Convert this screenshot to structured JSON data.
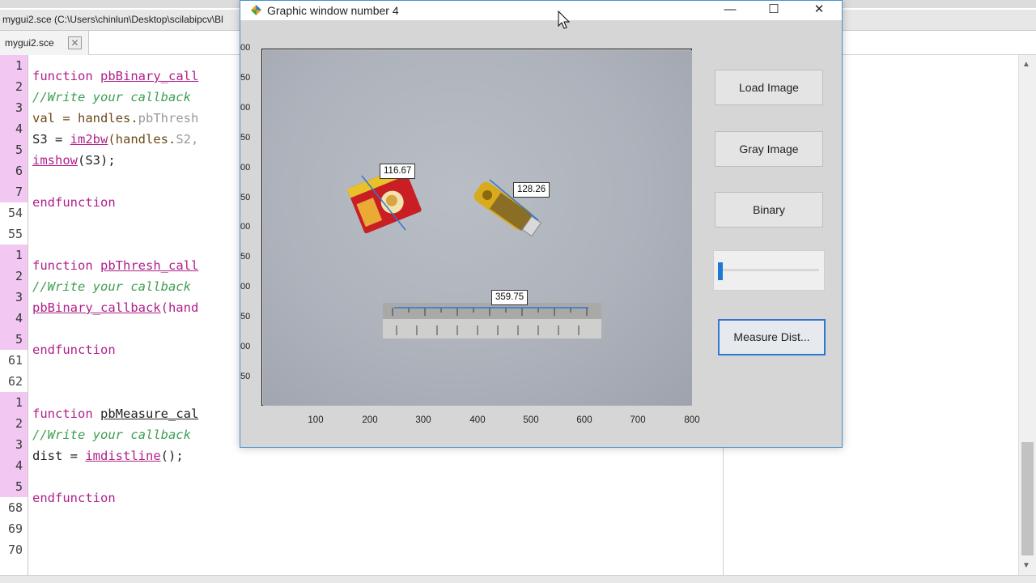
{
  "editor": {
    "path_title": "mygui2.sce (C:\\Users\\chinlun\\Desktop\\scilabipcv\\Bl",
    "tab_label": "mygui2.sce",
    "tab_close": "✕",
    "gutter": [
      {
        "num": "1",
        "local": true
      },
      {
        "num": "2",
        "local": true
      },
      {
        "num": "3",
        "local": true
      },
      {
        "num": "4",
        "local": true
      },
      {
        "num": "5",
        "local": true
      },
      {
        "num": "6",
        "local": true
      },
      {
        "num": "7",
        "local": true
      },
      {
        "num": "54",
        "local": false
      },
      {
        "num": "55",
        "local": false
      },
      {
        "num": "1",
        "local": true
      },
      {
        "num": "2",
        "local": true
      },
      {
        "num": "3",
        "local": true
      },
      {
        "num": "4",
        "local": true
      },
      {
        "num": "5",
        "local": true
      },
      {
        "num": "61",
        "local": false
      },
      {
        "num": "62",
        "local": false
      },
      {
        "num": "1",
        "local": true
      },
      {
        "num": "2",
        "local": true
      },
      {
        "num": "3",
        "local": true
      },
      {
        "num": "4",
        "local": true
      },
      {
        "num": "5",
        "local": true
      },
      {
        "num": "68",
        "local": false
      },
      {
        "num": "69",
        "local": false
      },
      {
        "num": "70",
        "local": false
      }
    ],
    "code": {
      "l1_kw": "function",
      "l1_fn": "pbBinary_call",
      "l2_cm": "//Write your callback",
      "l3_a": "val = handles.",
      "l3_b": "pbThresh",
      "l4_a": "S3 = ",
      "l4_b": "im2bw",
      "l4_c": "(handles.",
      "l4_d": "S2,",
      "l5_a": "imshow",
      "l5_b": "(S3);",
      "l7_kw": "endfunction",
      "l10_kw": "function",
      "l10_fn": "pbThresh_call",
      "l11_cm": "//Write your callback",
      "l12_a": "pbBinary_callback",
      "l12_b": "(hand",
      "l14_kw": "endfunction",
      "l17_kw": "function",
      "l17_fn": "pbMeasure_cal",
      "l18_cm": "//Write your callback",
      "l19_a": "dist = ",
      "l19_b": "imdistline",
      "l19_c": "();",
      "l21_kw": "endfunction"
    }
  },
  "graphic_window": {
    "title": "Graphic window number 4",
    "controls": {
      "minimize": "—",
      "maximize": "☐",
      "close": "✕"
    },
    "y_ticks": [
      "00",
      "50",
      "00",
      "50",
      "00",
      "50",
      "00",
      "50",
      "00",
      "50",
      "00",
      "50"
    ],
    "x_ticks": [
      "100",
      "200",
      "300",
      "400",
      "500",
      "600",
      "700",
      "800"
    ],
    "measurements": [
      "116.67",
      "128.26",
      "359.75"
    ],
    "buttons": {
      "load": "Load Image",
      "gray": "Gray Image",
      "binary": "Binary",
      "measure": "Measure Dist..."
    },
    "slider_value": 0.02
  },
  "colors": {
    "accent": "#2f77d1",
    "gutter_local": "#f2c8f2",
    "keyword": "#b0208a",
    "comment": "#3d9e52"
  }
}
